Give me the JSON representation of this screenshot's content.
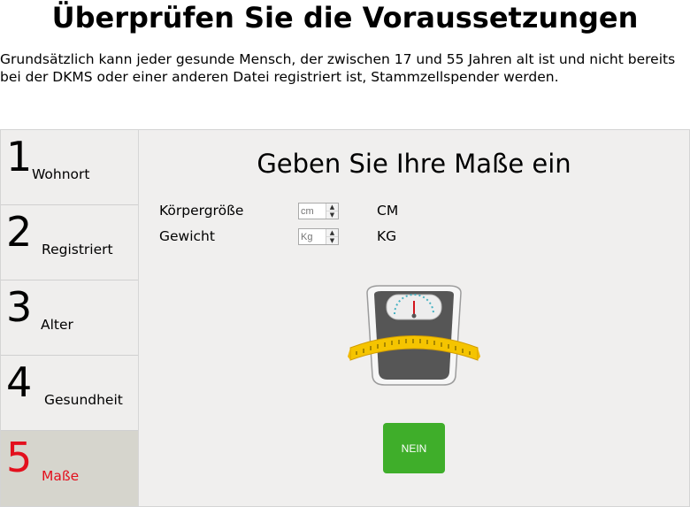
{
  "page": {
    "title": "Überprüfen Sie die Voraussetzungen",
    "intro": "Grundsätzlich kann jeder gesunde Mensch, der zwischen 17 und 55 Jahren alt ist und nicht bereits bei der DKMS oder einer anderen Datei registriert ist, Stammzellspender werden."
  },
  "steps": [
    {
      "number": "1",
      "label": "Wohnort"
    },
    {
      "number": "2",
      "label": "Registriert"
    },
    {
      "number": "3",
      "label": "Alter"
    },
    {
      "number": "4",
      "label": "Gesundheit"
    },
    {
      "number": "5",
      "label": "Maße",
      "active": true
    }
  ],
  "colors": {
    "active_step": "#e3101d",
    "button": "#3fae2a",
    "panel_bg": "#f0efee",
    "active_step_bg": "#d6d5cd"
  },
  "form": {
    "heading": "Geben Sie Ihre Maße ein",
    "fields": [
      {
        "label": "Körpergröße",
        "placeholder": "cm",
        "value": "",
        "unit": "CM"
      },
      {
        "label": "Gewicht",
        "placeholder": "Kg",
        "value": "",
        "unit": "KG"
      }
    ]
  },
  "illustration": {
    "icon": "bathroom-scale-with-measuring-tape-icon"
  },
  "button": {
    "label": "NEIN"
  }
}
